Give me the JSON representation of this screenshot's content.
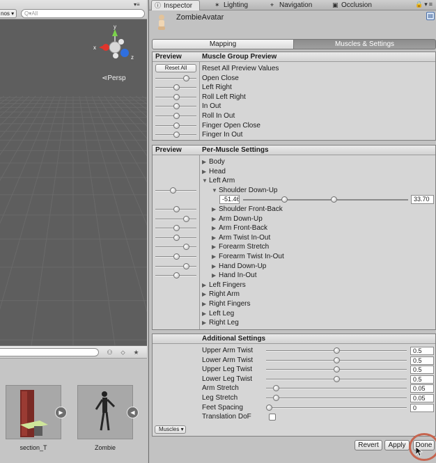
{
  "scene": {
    "gizmos_label": "nos ▾",
    "search_placeholder": "Q▾All",
    "axis_labels": {
      "x": "x",
      "y": "y",
      "z": "z"
    },
    "persp_label": "Persp"
  },
  "project": {
    "assets": [
      {
        "name": "section_T"
      },
      {
        "name": "Zombie"
      }
    ]
  },
  "inspector": {
    "tabs": [
      {
        "label": "Inspector",
        "icon": "info-icon",
        "active": true
      },
      {
        "label": "Lighting",
        "icon": "lighting-icon",
        "active": false
      },
      {
        "label": "Navigation",
        "icon": "navigation-icon",
        "active": false
      },
      {
        "label": "Occlusion",
        "icon": "occlusion-icon",
        "active": false
      }
    ],
    "avatar_name": "ZombieAvatar",
    "mode_tabs": {
      "mapping": "Mapping",
      "muscles": "Muscles & Settings"
    },
    "muscle_group": {
      "header_left": "Preview",
      "header_right": "Muscle Group Preview",
      "reset_button": "Reset All",
      "rows": [
        {
          "label": "Reset All Preview Values",
          "slider": null
        },
        {
          "label": "Open Close",
          "slider": 0.75
        },
        {
          "label": "Left Right",
          "slider": 0.5
        },
        {
          "label": "Roll Left Right",
          "slider": 0.5
        },
        {
          "label": "In Out",
          "slider": 0.5
        },
        {
          "label": "Roll In Out",
          "slider": 0.5
        },
        {
          "label": "Finger Open Close",
          "slider": 0.5
        },
        {
          "label": "Finger In Out",
          "slider": 0.5
        }
      ]
    },
    "per_muscle": {
      "header_left": "Preview",
      "header_right": "Per-Muscle Settings",
      "rows": [
        {
          "label": "Body",
          "depth": 0,
          "expanded": false,
          "slider": null
        },
        {
          "label": "Head",
          "depth": 0,
          "expanded": false,
          "slider": null
        },
        {
          "label": "Left Arm",
          "depth": 0,
          "expanded": true,
          "slider": null
        },
        {
          "label": "Shoulder Down-Up",
          "depth": 1,
          "expanded": true,
          "slider": 0.42
        },
        {
          "label": "Shoulder Front-Back",
          "depth": 1,
          "expanded": false,
          "slider": 0.5
        },
        {
          "label": "Arm Down-Up",
          "depth": 1,
          "expanded": false,
          "slider": 0.75
        },
        {
          "label": "Arm Front-Back",
          "depth": 1,
          "expanded": false,
          "slider": 0.5
        },
        {
          "label": "Arm Twist In-Out",
          "depth": 1,
          "expanded": false,
          "slider": 0.5
        },
        {
          "label": "Forearm Stretch",
          "depth": 1,
          "expanded": false,
          "slider": 0.75
        },
        {
          "label": "Forearm Twist In-Out",
          "depth": 1,
          "expanded": false,
          "slider": 0.5
        },
        {
          "label": "Hand Down-Up",
          "depth": 1,
          "expanded": false,
          "slider": 0.75
        },
        {
          "label": "Hand In-Out",
          "depth": 1,
          "expanded": false,
          "slider": 0.5
        },
        {
          "label": "Left Fingers",
          "depth": 0,
          "expanded": false,
          "slider": null
        },
        {
          "label": "Right Arm",
          "depth": 0,
          "expanded": false,
          "slider": null
        },
        {
          "label": "Right Fingers",
          "depth": 0,
          "expanded": false,
          "slider": null
        },
        {
          "label": "Left Leg",
          "depth": 0,
          "expanded": false,
          "slider": null
        },
        {
          "label": "Right Leg",
          "depth": 0,
          "expanded": false,
          "slider": null
        }
      ],
      "range": {
        "min_text": "-51.46",
        "max_text": "33.70",
        "low": 0.25,
        "high": 0.55
      }
    },
    "additional": {
      "header": "Additional Settings",
      "rows": [
        {
          "label": "Upper Arm Twist",
          "value": "0.5",
          "slider": 0.5
        },
        {
          "label": "Lower Arm Twist",
          "value": "0.5",
          "slider": 0.5
        },
        {
          "label": "Upper Leg Twist",
          "value": "0.5",
          "slider": 0.5
        },
        {
          "label": "Lower Leg Twist",
          "value": "0.5",
          "slider": 0.5
        },
        {
          "label": "Arm Stretch",
          "value": "0.05",
          "slider": 0.07
        },
        {
          "label": "Leg Stretch",
          "value": "0.05",
          "slider": 0.07
        },
        {
          "label": "Feet Spacing",
          "value": "0",
          "slider": 0.02
        },
        {
          "label": "Translation DoF",
          "checkbox": false
        }
      ]
    },
    "muscles_dropdown": "Muscles ▾",
    "buttons": {
      "revert": "Revert",
      "apply": "Apply",
      "done": "Done"
    }
  }
}
